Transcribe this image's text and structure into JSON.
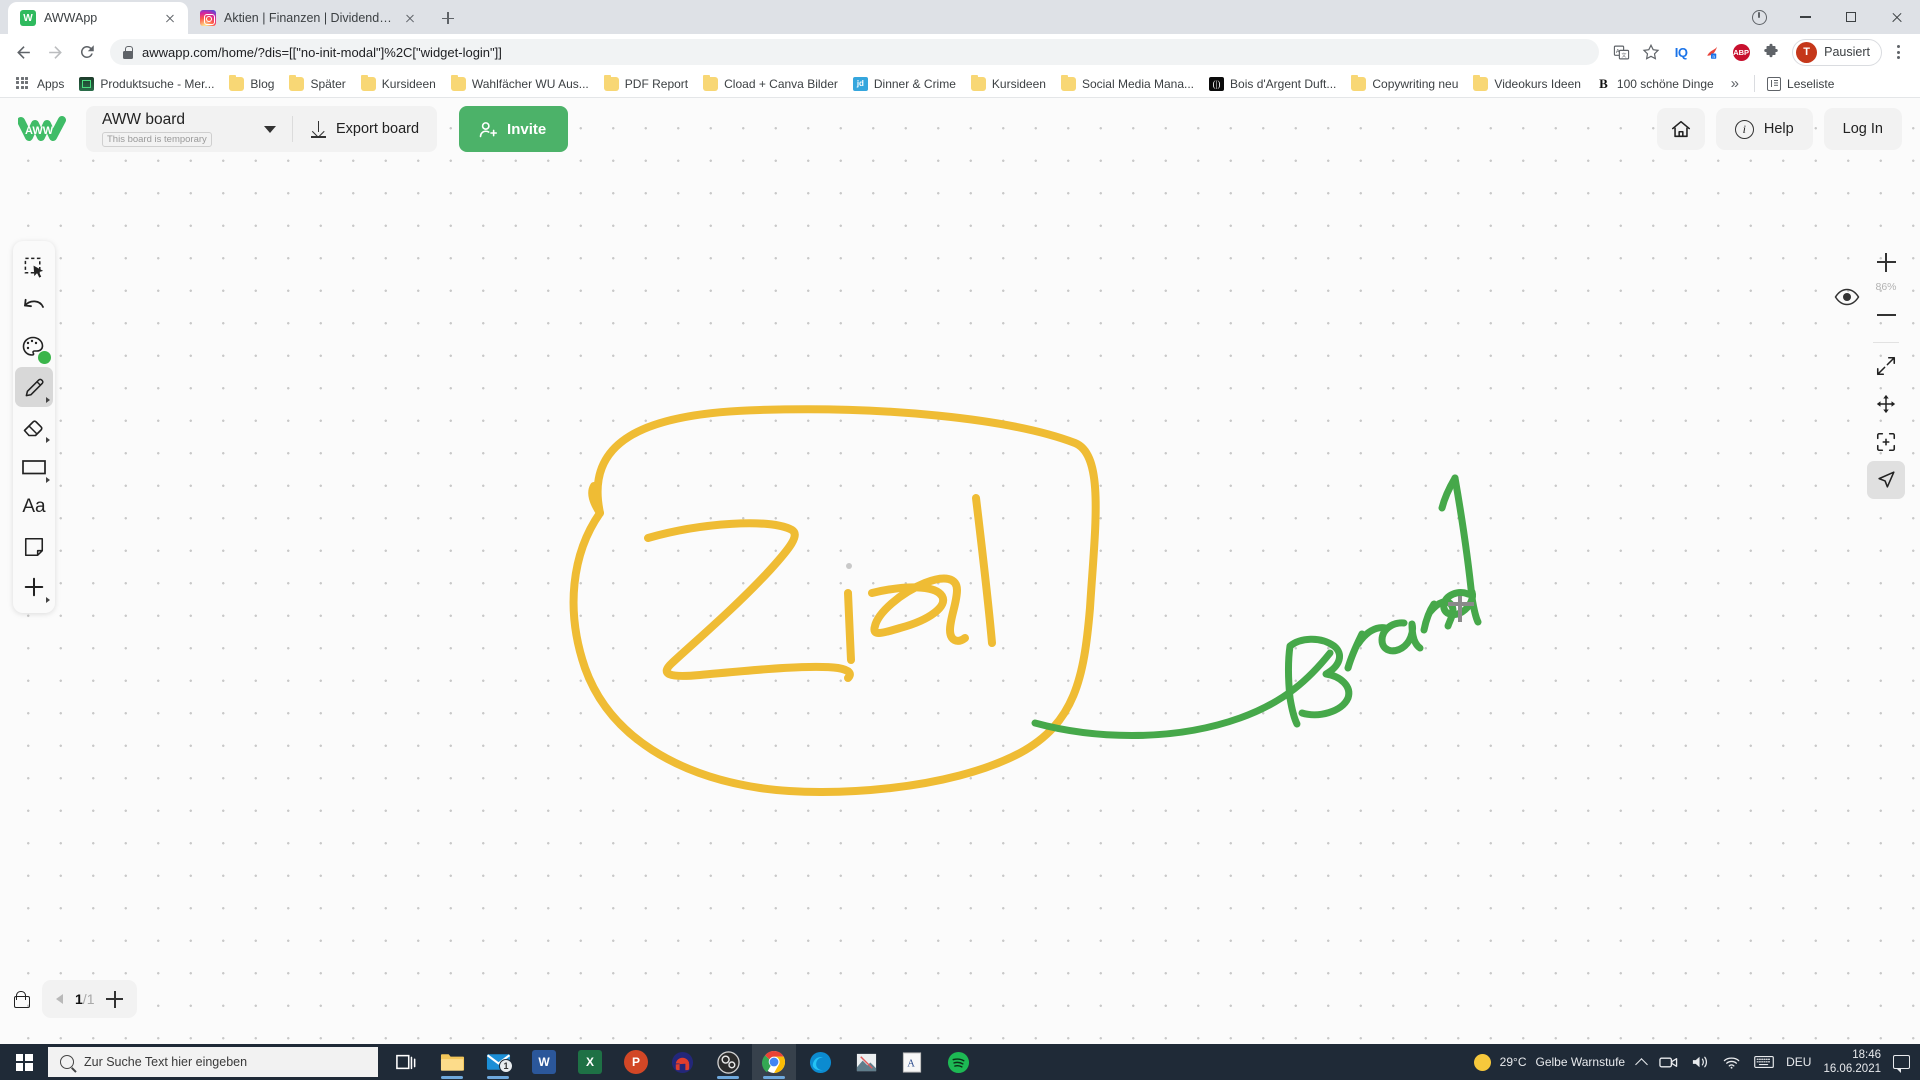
{
  "browser": {
    "tabs": [
      {
        "title": "AWWApp",
        "favicon": "aww-icon",
        "active": true
      },
      {
        "title": "Aktien | Finanzen | Dividende (@",
        "favicon": "instagram-icon",
        "active": false
      }
    ],
    "url": "awwapp.com/home/?dis=[[\"no-init-modal\"]%2C[\"widget-login\"]]",
    "extensions": [
      {
        "name": "translate-icon",
        "label": ""
      },
      {
        "name": "bookmark-star-icon",
        "label": ""
      },
      {
        "name": "iq-extension-icon",
        "label": "IQ"
      },
      {
        "name": "bird-extension-icon",
        "label": ""
      },
      {
        "name": "adblock-plus-icon",
        "label": "ABP"
      },
      {
        "name": "extensions-puzzle-icon",
        "label": ""
      }
    ],
    "profile": {
      "initial": "T",
      "label": "Pausiert"
    },
    "bookmarks": [
      {
        "label": "Apps",
        "icon": "apps-grid-icon"
      },
      {
        "label": "Produktsuche - Mer...",
        "icon": "green-site-icon"
      },
      {
        "label": "Blog",
        "icon": "folder-icon"
      },
      {
        "label": "Später",
        "icon": "folder-icon"
      },
      {
        "label": "Kursideen",
        "icon": "folder-icon"
      },
      {
        "label": "Wahlfächer WU Aus...",
        "icon": "folder-icon"
      },
      {
        "label": "PDF Report",
        "icon": "folder-icon"
      },
      {
        "label": "Cload + Canva Bilder",
        "icon": "folder-icon"
      },
      {
        "label": "Dinner & Crime",
        "icon": "jd-site-icon"
      },
      {
        "label": "Kursideen",
        "icon": "folder-icon"
      },
      {
        "label": "Social Media Mana...",
        "icon": "folder-icon"
      },
      {
        "label": "Bois d'Argent Duft...",
        "icon": "black-site-icon"
      },
      {
        "label": "Copywriting neu",
        "icon": "folder-icon"
      },
      {
        "label": "Videokurs Ideen",
        "icon": "folder-icon"
      },
      {
        "label": "100 schöne Dinge",
        "icon": "b-site-icon"
      }
    ],
    "bookmarks_overflow": "»",
    "reading_list": "Leseliste"
  },
  "app": {
    "logo_text": "AWW",
    "board": {
      "name": "AWW board",
      "temporary_badge": "This board is temporary"
    },
    "export_label": "Export board",
    "invite_label": "Invite",
    "help_label": "Help",
    "login_label": "Log In",
    "home_icon": "home-icon",
    "tools": [
      {
        "name": "select-tool",
        "icon": "selection-cursor-icon",
        "active": false,
        "has_arrow": false
      },
      {
        "name": "undo-tool",
        "icon": "undo-arrow-icon",
        "active": false,
        "has_arrow": false
      },
      {
        "name": "color-tool",
        "icon": "palette-icon",
        "active": false,
        "has_arrow": false,
        "color": "#3ab54a"
      },
      {
        "name": "pen-tool",
        "icon": "pencil-icon",
        "active": true,
        "has_arrow": true
      },
      {
        "name": "eraser-tool",
        "icon": "eraser-icon",
        "active": false,
        "has_arrow": true
      },
      {
        "name": "shape-tool",
        "icon": "rectangle-icon",
        "active": false,
        "has_arrow": true
      },
      {
        "name": "text-tool",
        "icon": "text-aa-icon",
        "label": "Aa",
        "active": false,
        "has_arrow": false
      },
      {
        "name": "sticky-note-tool",
        "icon": "sticky-note-icon",
        "active": false,
        "has_arrow": false
      },
      {
        "name": "add-tool",
        "icon": "plus-icon",
        "active": false,
        "has_arrow": true
      }
    ],
    "zoom": {
      "level": "86%",
      "in_icon": "zoom-in-icon",
      "out_icon": "zoom-out-icon",
      "fit_icon": "fit-screen-icon",
      "pan_icon": "pan-move-icon",
      "frame_icon": "focus-frame-icon",
      "pointer_icon": "laser-pointer-icon"
    },
    "visibility_icon": "eye-icon",
    "page": {
      "current": "1",
      "separator": "/",
      "total": "1",
      "lock_icon": "lock-icon",
      "prev_icon": "prev-page-icon",
      "add_icon": "add-page-icon"
    },
    "canvas": {
      "annotations": [
        {
          "text": "Ziel",
          "color": "#efbc34",
          "style": "handwritten-circled"
        },
        {
          "text": "Brand",
          "color": "#46a84a",
          "style": "handwritten-diagonal"
        }
      ],
      "accent_yellow": "#efbc34",
      "accent_green": "#46a84a"
    },
    "brand_green": "#4cb269"
  },
  "taskbar": {
    "search_placeholder": "Zur Suche Text hier eingeben",
    "apps": [
      {
        "name": "task-view-icon",
        "label": ""
      },
      {
        "name": "file-explorer-icon",
        "label": ""
      },
      {
        "name": "mail-icon",
        "label": "",
        "badge": "1"
      },
      {
        "name": "word-icon",
        "label": "W"
      },
      {
        "name": "excel-icon",
        "label": "X"
      },
      {
        "name": "powerpoint-icon",
        "label": "P"
      },
      {
        "name": "audio-app-icon",
        "label": ""
      },
      {
        "name": "obs-icon",
        "label": ""
      },
      {
        "name": "chrome-icon",
        "label": ""
      },
      {
        "name": "edge-icon",
        "label": ""
      },
      {
        "name": "photos-icon",
        "label": ""
      },
      {
        "name": "notes-app-icon",
        "label": "A"
      },
      {
        "name": "spotify-icon",
        "label": ""
      }
    ],
    "weather": {
      "temp": "29°C",
      "condition": "Gelbe Warnstufe"
    },
    "language": "DEU",
    "time": "18:46",
    "date": "16.06.2021"
  }
}
